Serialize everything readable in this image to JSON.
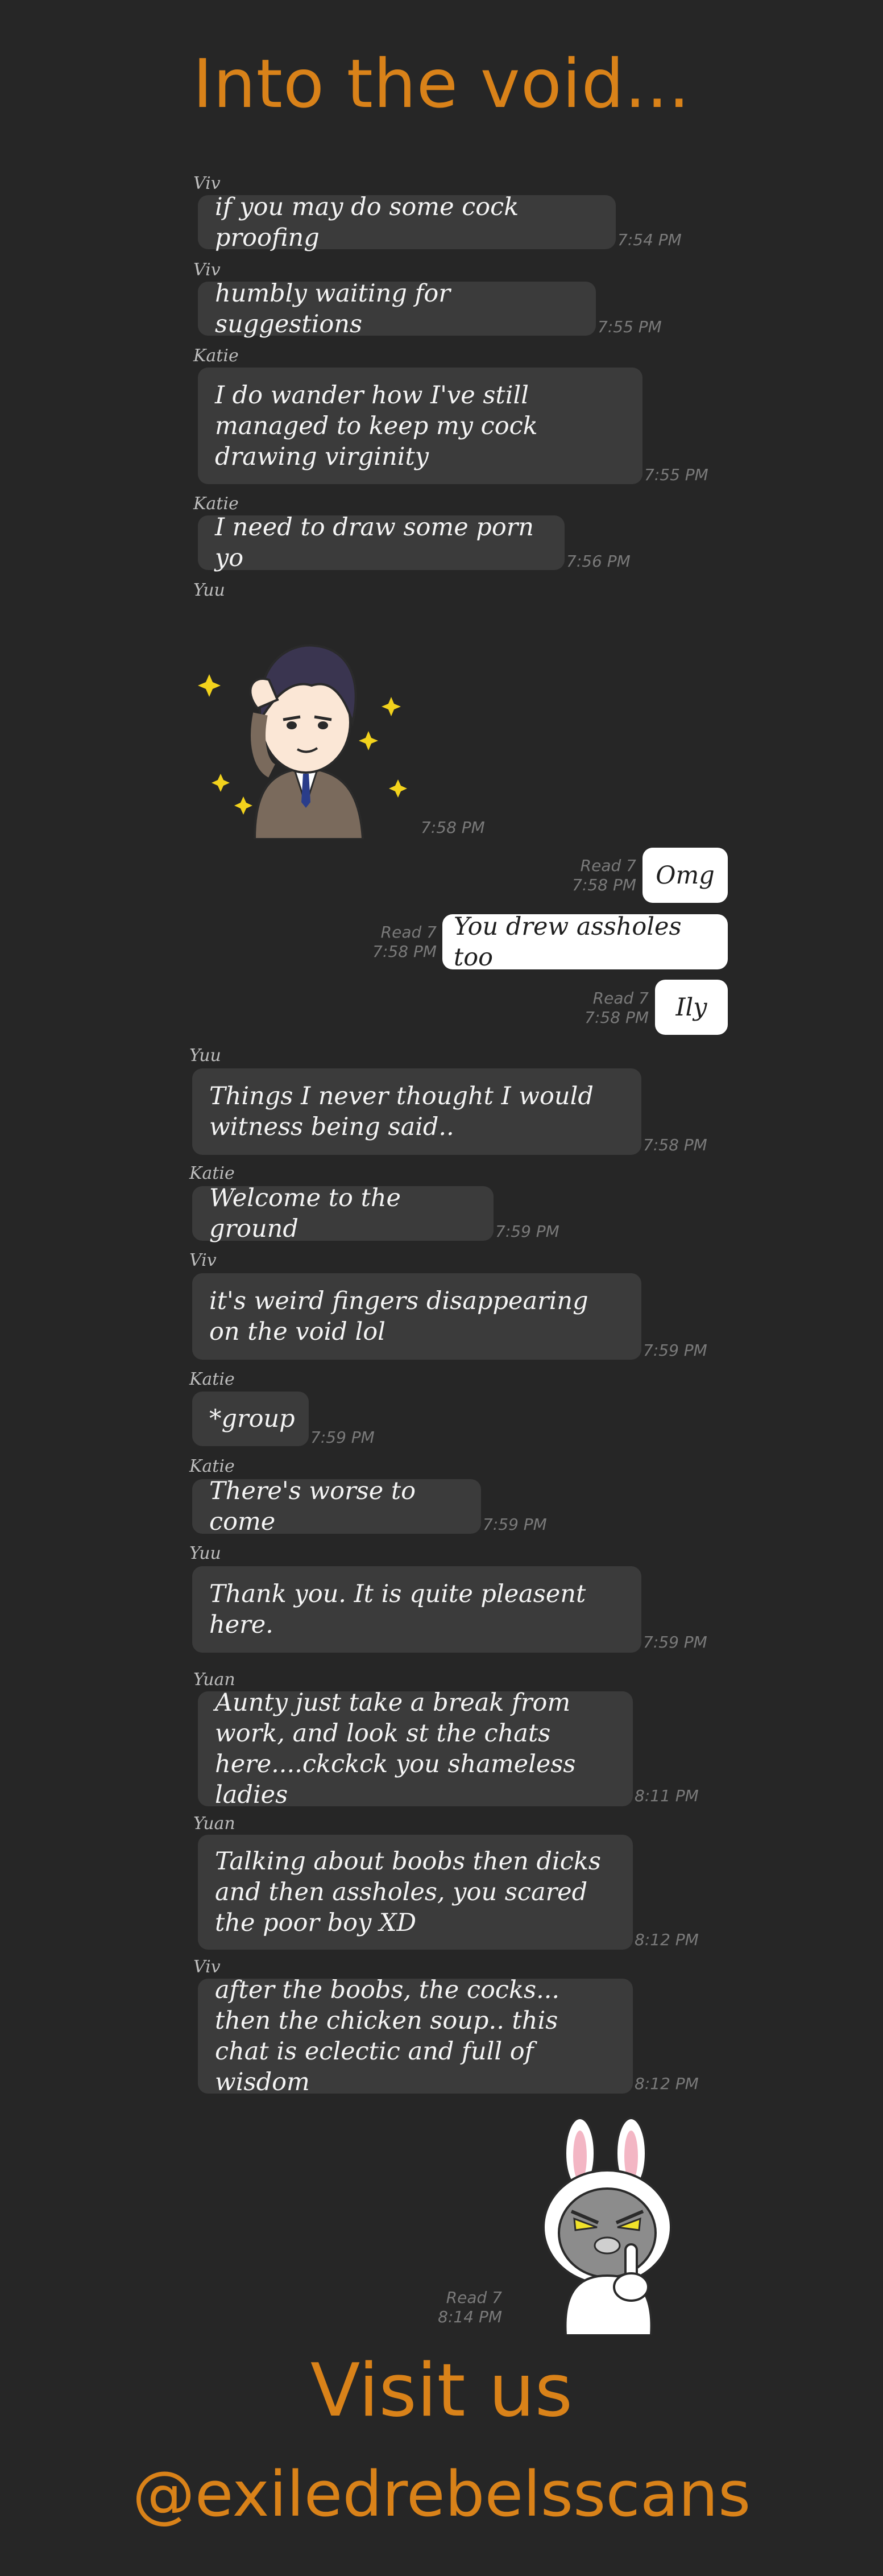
{
  "title": "Into the void...",
  "messages": [
    {
      "sender": "Viv",
      "text": "if you may do some cock proofing",
      "time": "7:54 PM"
    },
    {
      "sender": "Viv",
      "text": "humbly waiting for suggestions",
      "time": "7:55 PM"
    },
    {
      "sender": "Katie",
      "text": "I do wander how I've still managed to keep my cock drawing virginity",
      "time": "7:55 PM"
    },
    {
      "sender": "Katie",
      "text": "I need to draw some porn yo",
      "time": "7:56 PM"
    },
    {
      "sender": "Yuu",
      "sticker": "businessman-salute-sticker",
      "time": "7:58 PM"
    },
    {
      "read": "Read 7",
      "text": "Omg",
      "time": "7:58 PM"
    },
    {
      "read": "Read 7",
      "text": "You drew assholes too",
      "time": "7:58 PM"
    },
    {
      "read": "Read 7",
      "text": "Ily",
      "time": "7:58 PM"
    },
    {
      "sender": "Yuu",
      "text": "Things I never thought I would witness being said..",
      "time": "7:58 PM"
    },
    {
      "sender": "Katie",
      "text": "Welcome to the ground",
      "time": "7:59 PM"
    },
    {
      "sender": "Viv",
      "text": "it's weird fingers disappearing on the void lol",
      "time": "7:59 PM"
    },
    {
      "sender": "Katie",
      "text": "*group",
      "time": "7:59 PM"
    },
    {
      "sender": "Katie",
      "text": "There's worse to come",
      "time": "7:59 PM"
    },
    {
      "sender": "Yuu",
      "text": "Thank you. It is quite pleasent here.",
      "time": "7:59 PM"
    },
    {
      "sender": "Yuan",
      "text": "Aunty just take a break from work, and look st the chats here....ckckck you shameless ladies",
      "time": "8:11 PM"
    },
    {
      "sender": "Yuan",
      "text": "Talking about boobs then dicks and then assholes, you scared the poor boy XD",
      "time": "8:12 PM"
    },
    {
      "sender": "Viv",
      "text": "after the boobs, the cocks... then the chicken soup.. this chat is eclectic and full of wisdom",
      "time": "8:12 PM"
    },
    {
      "read": "Read 7",
      "sticker": "bunny-shush-sticker",
      "time": "8:14 PM"
    }
  ],
  "footer": {
    "line1": "Visit us",
    "line2": "@exiledrebelsscans"
  },
  "colors": {
    "background": "#262626",
    "incoming_bubble": "#3b3b3b",
    "outgoing_bubble": "#ffffff",
    "accent": "#d98219"
  }
}
